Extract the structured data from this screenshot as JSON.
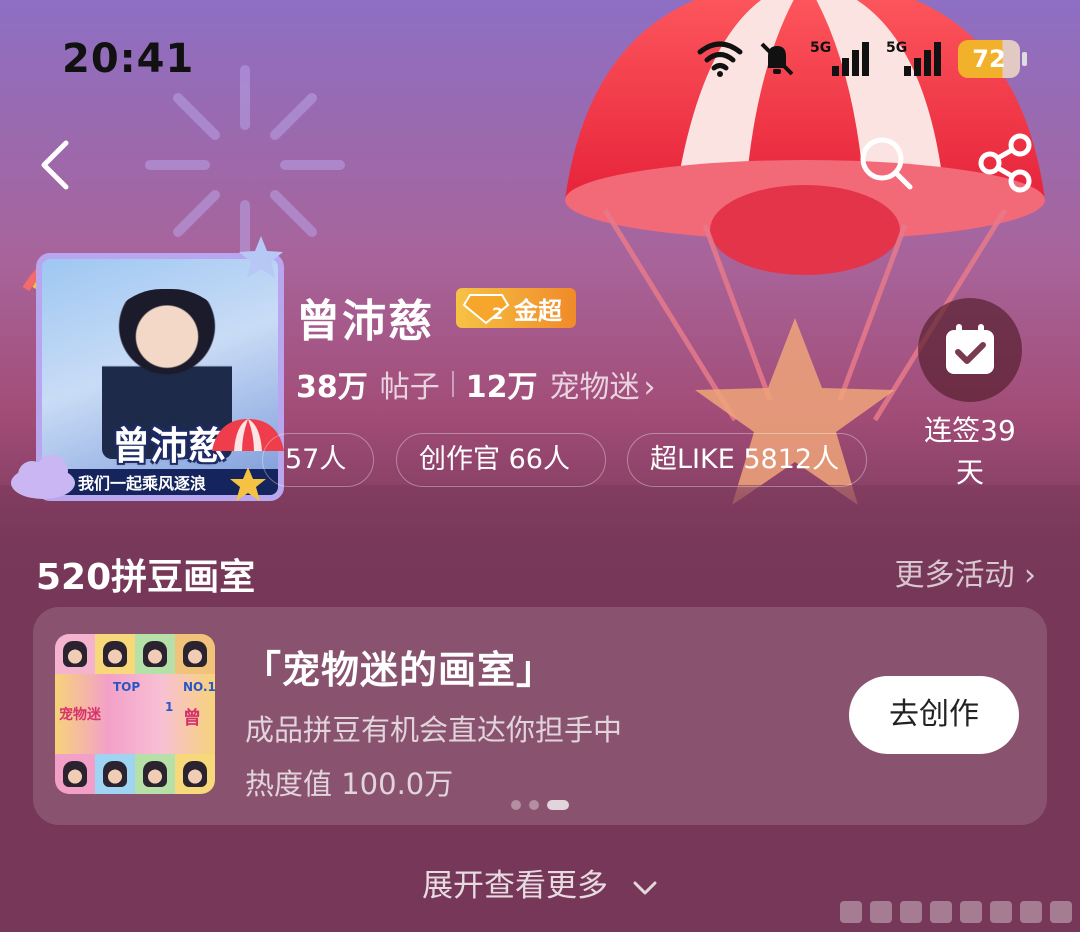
{
  "status_bar": {
    "time": "20:41",
    "network_1": "5G",
    "network_2": "5G",
    "battery": "72",
    "icons": [
      "wifi-icon",
      "mute-bell-icon",
      "signal-icon",
      "signal-icon",
      "battery-icon"
    ]
  },
  "nav": {
    "icons": [
      "back-arrow-icon",
      "search-icon",
      "share-icon"
    ]
  },
  "profile": {
    "name": "曾沛慈",
    "level_text": "金超",
    "level_number": "2",
    "avatar_name": "曾沛慈",
    "avatar_slogan": "我们一起乘风逐浪",
    "posts_count": "38万",
    "posts_label": "帖子",
    "fans_count": "12万",
    "fans_label": "宠物迷",
    "chevron": "›"
  },
  "pills": [
    {
      "label": "57人"
    },
    {
      "label": "创作官 66人"
    },
    {
      "label": "超LIKE 5812人"
    }
  ],
  "signin": {
    "label": "连签39\n天",
    "line1": "连签39",
    "line2": "天",
    "icon": "calendar-check-icon"
  },
  "section": {
    "title": "520拼豆画室",
    "more": "更多活动 ›"
  },
  "activity": {
    "title": "「宠物迷的画室」",
    "desc": "成品拼豆有机会直达你担手中",
    "heat": "热度值 100.0万",
    "button": "去创作",
    "thumb_texts": [
      "TOP",
      "1",
      "NO.1",
      "宠物迷",
      "曾"
    ],
    "page_indicator": {
      "total": 3,
      "active": 3
    }
  },
  "expand": {
    "label": "展开查看更多"
  },
  "colors": {
    "background_top": "#8d6fc4",
    "background_bottom": "#74365a",
    "badge_gold": "#f6c244",
    "button_white": "#ffffff"
  }
}
